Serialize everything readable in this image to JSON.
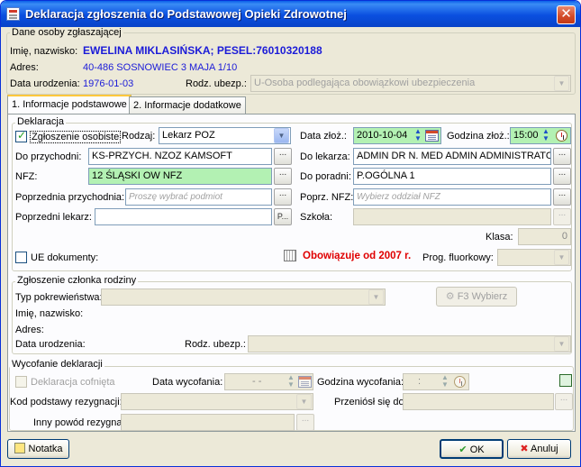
{
  "window": {
    "title": "Deklaracja zgłoszenia do Podstawowej Opieki Zdrowotnej",
    "close_glyph": "✕"
  },
  "applicant": {
    "legend": "Dane osoby zgłaszającej",
    "name_label": "Imię, nazwisko:",
    "name_value": "EWELINA MIKLASIŃSKA; PESEL:76010320188",
    "address_label": "Adres:",
    "address_value": "40-486 SOSNOWIEC 3 MAJA 1/10",
    "birth_label": "Data urodzenia:",
    "birth_value": "1976-01-03",
    "insurance_label": "Rodz. ubezp.:",
    "insurance_value": "U-Osoba podlegająca obowiązkowi ubezpieczenia"
  },
  "tabs": [
    {
      "label": "1. Informacje podstawowe",
      "active": true
    },
    {
      "label": "2. Informacje dodatkowe",
      "active": false
    }
  ],
  "declaration": {
    "legend": "Deklaracja",
    "personal_label": "Zgłoszenie osobiste",
    "personal_checked": true,
    "type_label": "Rodzaj:",
    "type_value": "Lekarz POZ",
    "date_label": "Data złoż.:",
    "date_value": "2010-10-04",
    "hour_label": "Godzina złoż.:",
    "hour_value": "15:00",
    "clinic_label": "Do przychodni:",
    "clinic_value": "KS-PRZYCH. NZOZ KAMSOFT",
    "doctor_label": "Do lekarza:",
    "doctor_value": "ADMIN DR N. MED ADMIN ADMINISTRATOR",
    "nfz_label": "NFZ:",
    "nfz_value": "12 ŚLĄSKI OW NFZ",
    "outpatient_label": "Do poradni:",
    "outpatient_value": "P.OGÓLNA 1",
    "prev_clinic_label": "Poprzednia przychodnia:",
    "prev_clinic_placeholder": "Proszę wybrać podmiot",
    "prev_nfz_label": "Poprz. NFZ:",
    "prev_nfz_placeholder": "Wybierz oddział NFZ",
    "prev_doctor_label": "Poprzedni lekarz:",
    "school_label": "Szkoła:",
    "class_label": "Klasa:",
    "class_value": "0",
    "ue_label": "UE dokumenty:",
    "valid_text": "Obowiązuje od 2007 r.",
    "fluoride_label": "Prog. fluorkowy:",
    "dots": "...",
    "p_btn": "P..."
  },
  "family": {
    "legend": "Zgłoszenie członka rodziny",
    "relation_label": "Typ pokrewieństwa:",
    "select_btn": "F3 Wybierz",
    "name_label": "Imię, nazwisko:",
    "address_label": "Adres:",
    "birth_label": "Data urodzenia:",
    "insurance_label": "Rodz. ubezp.:"
  },
  "withdrawal": {
    "legend": "Wycofanie deklaracji",
    "withdrawn_label": "Deklaracja cofnięta",
    "date_label": "Data wycofania:",
    "date_value": "-   -",
    "hour_label": "Godzina wycofania:",
    "hour_value": ":",
    "reason_code_label": "Kod podstawy rezygnacji:",
    "moved_label": "Przeniósł się do:",
    "other_reason_label": "Inny powód rezygnacji:",
    "dots": "..."
  },
  "footer": {
    "note": "Notatka",
    "ok": "OK",
    "cancel": "Anuluj"
  },
  "icons": {
    "arrow_down": "▼",
    "spin_up": "▲",
    "spin_down": "▼",
    "ok_glyph": "✔",
    "cancel_glyph": "✖"
  }
}
